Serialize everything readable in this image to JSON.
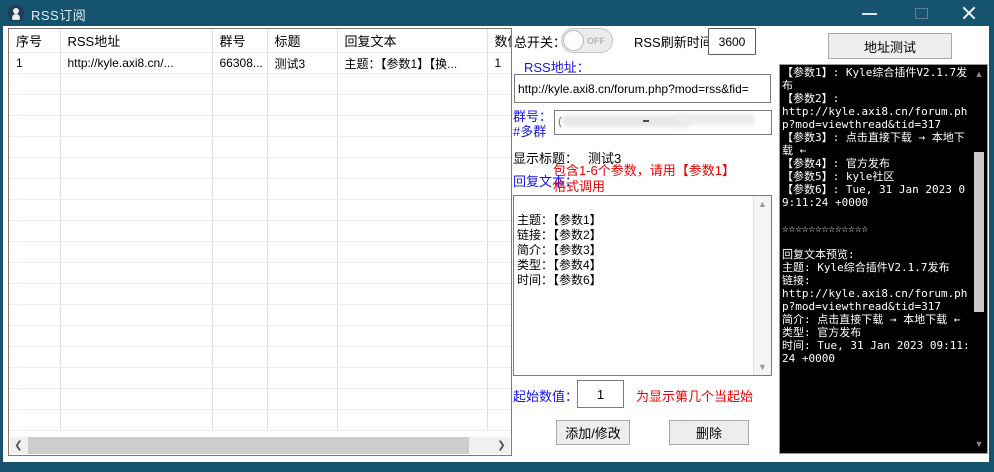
{
  "window": {
    "title": "RSS订阅"
  },
  "table": {
    "headers": [
      "序号",
      "RSS地址",
      "群号",
      "标题",
      "回复文本",
      "数值"
    ],
    "rows": [
      {
        "cells": [
          "1",
          "http://kyle.axi8.cn/...",
          "66308...",
          "测试3",
          "主题：【参数1】【换...",
          "1"
        ]
      }
    ],
    "empty_row_count": 17
  },
  "controls": {
    "master_switch_label": "总开关：",
    "toggle_state": "OFF",
    "refresh_label": "RSS刷新时间：",
    "refresh_value": "3600",
    "rss_url_label": "RSS地址：",
    "rss_url_value": "http://kyle.axi8.cn/forum.php?mod=rss&fid=",
    "group_label": "群号：\n#多群",
    "display_title_label": "显示标题：",
    "display_title_value": "测试3",
    "reply_label": "回复文本：",
    "reply_hint": "包含1-6个参数，请用【参数1】\n格式调用",
    "reply_template": "主题：【参数1】\n链接：【参数2】\n简介：【参数3】\n类型：【参数4】\n时间：【参数6】",
    "start_label": "起始数值：",
    "start_value": "1",
    "start_hint": "为显示第几个当起始",
    "add_button": "添加/修改",
    "delete_button": "删除",
    "test_button": "地址测试"
  },
  "console": {
    "text": "【参数1】: Kyle综合插件V2.1.7发布\n【参数2】: \nhttp://kyle.axi8.cn/forum.php?mod=viewthread&tid=317\n【参数3】: 点击直接下载 → 本地下载 ←\n【参数4】: 官方发布\n【参数5】: kyle社区\n【参数6】: Tue, 31 Jan 2023 09:11:24 +0000\n\n☆☆☆☆☆☆☆☆☆☆☆☆☆\n\n回复文本预览: \n主题: Kyle综合插件V2.1.7发布\n链接: \nhttp://kyle.axi8.cn/forum.php?mod=viewthread&tid=317\n简介: 点击直接下载 → 本地下载 ←\n类型: 官方发布\n时间: Tue, 31 Jan 2023 09:11:24 +0000"
  },
  "colors": {
    "titlebar": "#15536f",
    "label_blue": "#1414ee",
    "hint_red": "#ee0000",
    "console_bg": "#000000",
    "console_text": "#ffffff"
  }
}
